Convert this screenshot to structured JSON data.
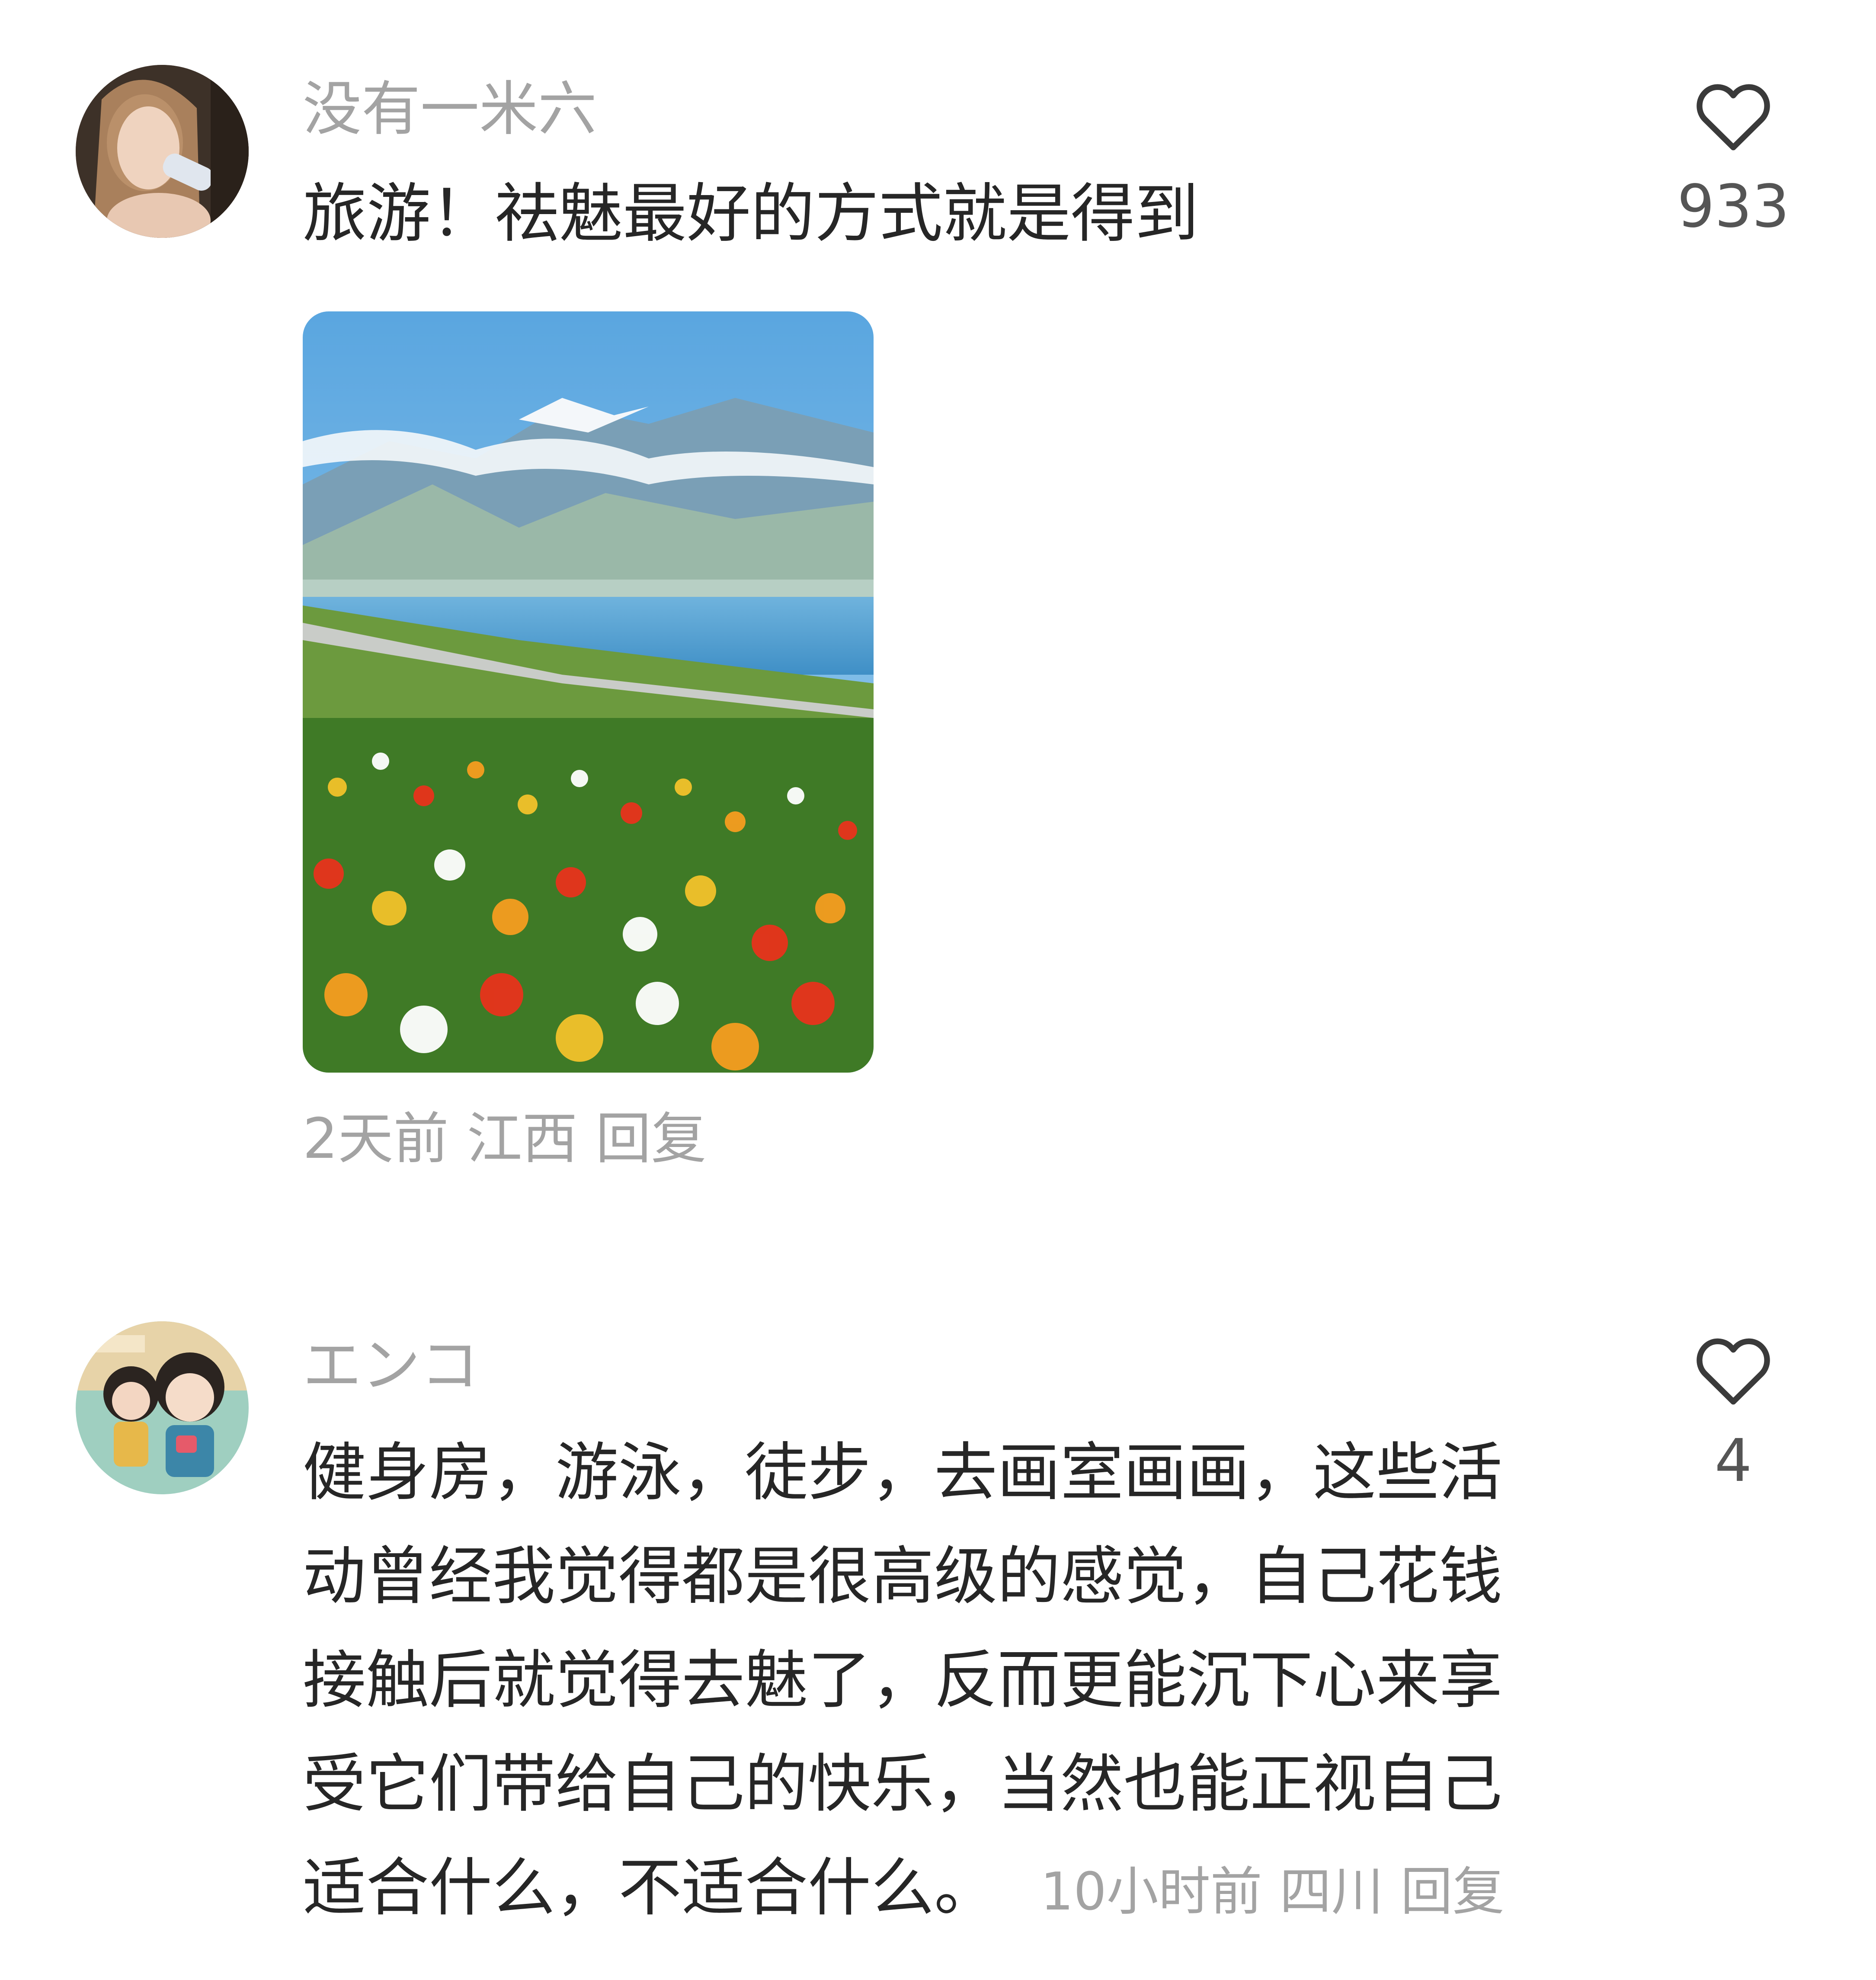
{
  "comments": [
    {
      "username": "没有一米六",
      "text": "旅游！祛魅最好的方式就是得到",
      "likes": "933",
      "time": "2天前",
      "location": "江西",
      "reply_label": "回复",
      "avatar_icon": "user-avatar-photo",
      "image_icon": "landscape-photo-flowers-lake-mountains"
    },
    {
      "username": "エンコ",
      "text_lines": [
        "健身房，游泳，徒步，去画室画画，这些活",
        "动曾经我觉得都是很高级的感觉，自己花钱",
        "接触后就觉得去魅了，反而更能沉下心来享",
        "受它们带给自己的快乐，当然也能正视自己",
        "适合什么，不适合什么。"
      ],
      "likes": "4",
      "time": "10小时前",
      "location": "四川",
      "reply_label": "回复",
      "avatar_icon": "user-avatar-figurines"
    }
  ],
  "colors": {
    "meta_text": "#a3a3a3",
    "body_text": "#262626",
    "heart_stroke": "#3a3a3a"
  }
}
